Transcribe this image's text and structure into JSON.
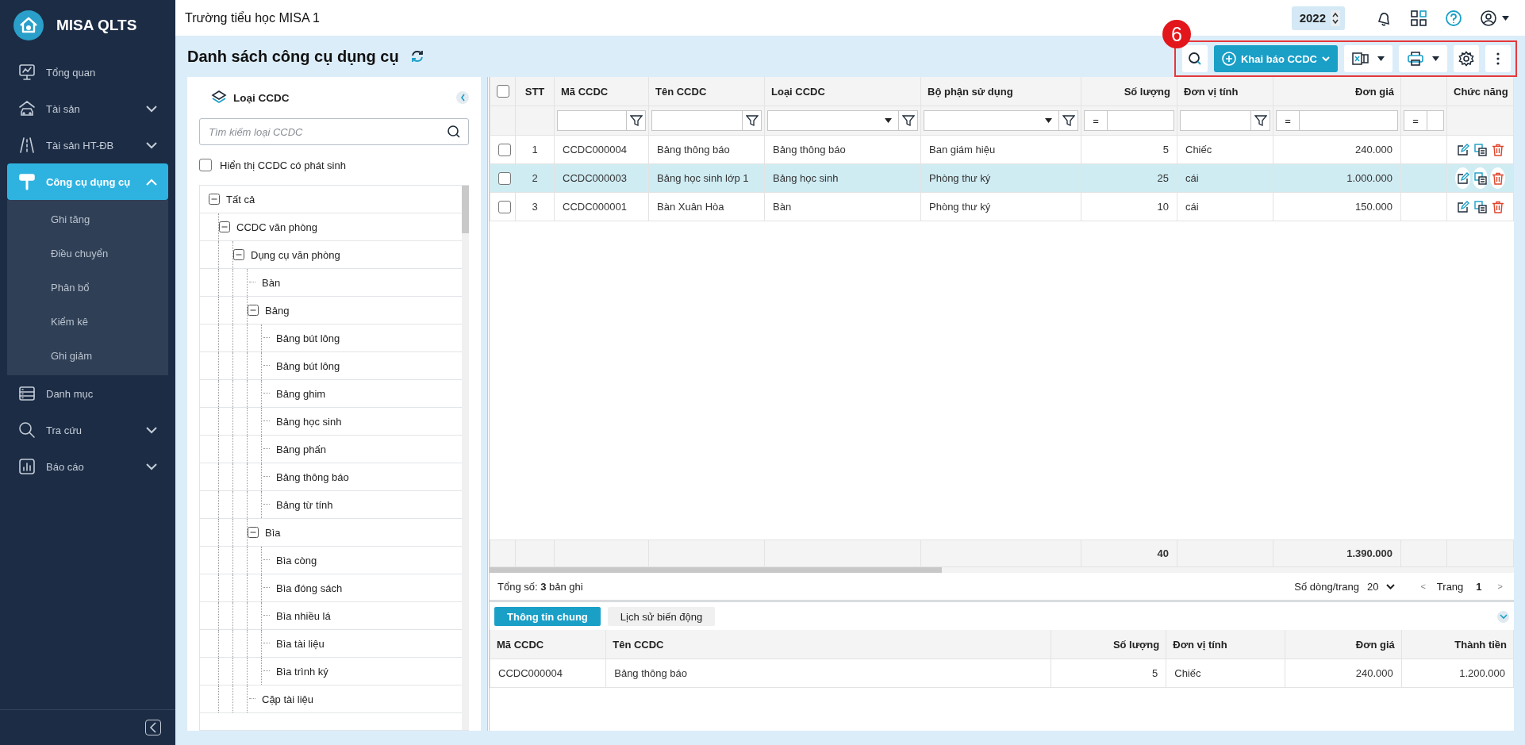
{
  "app": {
    "name": "MISA QLTS"
  },
  "sidebar": {
    "items": [
      {
        "label": "Tổng quan",
        "selected": false
      },
      {
        "label": "Tài sản",
        "selected": false,
        "expanded": false
      },
      {
        "label": "Tài sản HT-ĐB",
        "selected": false,
        "expanded": false
      },
      {
        "label": "Công cụ dụng cụ",
        "selected": true,
        "expanded": true,
        "children": [
          {
            "label": "Ghi tăng",
            "selected": false
          },
          {
            "label": "Điều chuyển",
            "selected": false
          },
          {
            "label": "Phân bổ",
            "selected": false
          },
          {
            "label": "Kiểm kê",
            "selected": false
          },
          {
            "label": "Ghi giảm",
            "selected": false
          }
        ]
      },
      {
        "label": "Danh mục",
        "selected": false
      },
      {
        "label": "Tra cứu",
        "selected": false,
        "expanded": false
      },
      {
        "label": "Báo cáo",
        "selected": false,
        "expanded": false
      }
    ]
  },
  "topbar": {
    "title": "Trường tiểu học MISA 1",
    "year": "2022"
  },
  "page": {
    "title": "Danh sách công cụ dụng cụ"
  },
  "annotation": {
    "label": "6"
  },
  "toolbar": {
    "primary_button": "Khai báo CCDC"
  },
  "category_panel": {
    "title": "Loại CCDC",
    "search": {
      "placeholder": "Tìm kiếm loại CCDC"
    },
    "filter_checkbox": {
      "label": "Hiển thị CCDC có phát sinh",
      "checked": false
    },
    "tree": [
      {
        "label": "Tất cả",
        "expanded": true,
        "children": [
          {
            "label": "CCDC văn phòng",
            "expanded": true,
            "children": [
              {
                "label": "Dụng cụ văn phòng",
                "expanded": true,
                "children": [
                  {
                    "label": "Bàn"
                  },
                  {
                    "label": "Bảng",
                    "expanded": true,
                    "children": [
                      {
                        "label": "Bảng bút lông"
                      },
                      {
                        "label": "Bảng bút lông"
                      },
                      {
                        "label": "Bảng ghim"
                      },
                      {
                        "label": "Bảng học sinh"
                      },
                      {
                        "label": "Bảng phấn"
                      },
                      {
                        "label": "Bảng thông báo"
                      },
                      {
                        "label": "Bảng từ tính"
                      }
                    ]
                  },
                  {
                    "label": "Bìa",
                    "expanded": true,
                    "children": [
                      {
                        "label": "Bìa còng"
                      },
                      {
                        "label": "Bìa đóng sách"
                      },
                      {
                        "label": "Bìa nhiều lá"
                      },
                      {
                        "label": "Bìa tài liệu"
                      },
                      {
                        "label": "Bìa trình ký"
                      }
                    ]
                  },
                  {
                    "label": "Cặp tài liệu"
                  }
                ]
              }
            ]
          }
        ]
      }
    ]
  },
  "table": {
    "columns": [
      {
        "kind": "check",
        "checked": false
      },
      {
        "kind": "center",
        "label": "STT"
      },
      {
        "kind": "text",
        "label": "Mã CCDC",
        "filter": {
          "kind": "text"
        }
      },
      {
        "kind": "text",
        "label": "Tên CCDC",
        "filter": {
          "kind": "text"
        }
      },
      {
        "kind": "text",
        "label": "Loại CCDC",
        "filter": {
          "kind": "select"
        }
      },
      {
        "kind": "text",
        "label": "Bộ phận sử dụng",
        "filter": {
          "kind": "select"
        }
      },
      {
        "kind": "number",
        "label": "Số lượng",
        "filter": {
          "kind": "number",
          "operator": "="
        },
        "total": "40"
      },
      {
        "kind": "text",
        "label": "Đơn vị tính",
        "filter": {
          "kind": "text"
        }
      },
      {
        "kind": "number",
        "label": "Đơn giá",
        "filter": {
          "kind": "number",
          "operator": "="
        },
        "total": "1.390.000"
      },
      {
        "kind": "number",
        "filter": {
          "kind": "number",
          "operator": "="
        }
      },
      {
        "kind": "actions",
        "label": "Chức năng"
      }
    ],
    "rows": [
      {
        "selected": false,
        "checked": false,
        "cells": [
          "",
          "1",
          "CCDC000004",
          "Bảng thông báo",
          "Bảng thông báo",
          "Ban giám hiệu",
          "5",
          "Chiếc",
          "240.000"
        ]
      },
      {
        "selected": true,
        "checked": false,
        "cells": [
          "",
          "2",
          "CCDC000003",
          "Bảng học sinh lớp 1",
          "Bảng học sinh",
          "Phòng thư ký",
          "25",
          "cái",
          "1.000.000"
        ]
      },
      {
        "selected": false,
        "checked": false,
        "cells": [
          "",
          "3",
          "CCDC000001",
          "Bàn Xuân Hòa",
          "Bàn",
          "Phòng thư ký",
          "10",
          "cái",
          "150.000"
        ]
      }
    ]
  },
  "pagination": {
    "summary": "Tổng số: **3** bản ghi",
    "page_size_label": "Số dòng/trang",
    "page_size": "20",
    "prev": "<",
    "page_label": "Trang",
    "page": "1",
    "next": ">"
  },
  "detail": {
    "tabs": [
      {
        "label": "Thông tin chung",
        "selected": true
      },
      {
        "label": "Lịch sử biến động",
        "selected": false
      }
    ],
    "columns": [
      {
        "label": "Mã CCDC",
        "kind": "text"
      },
      {
        "label": "Tên CCDC",
        "kind": "text"
      },
      {
        "label": "Số lượng",
        "kind": "number"
      },
      {
        "label": "Đơn vị tính",
        "kind": "text"
      },
      {
        "label": "Đơn giá",
        "kind": "number"
      },
      {
        "label": "Thành tiền",
        "kind": "number"
      }
    ],
    "rows": [
      [
        "CCDC000004",
        "Bảng thông báo",
        "5",
        "Chiếc",
        "240.000",
        "1.200.000"
      ]
    ]
  }
}
